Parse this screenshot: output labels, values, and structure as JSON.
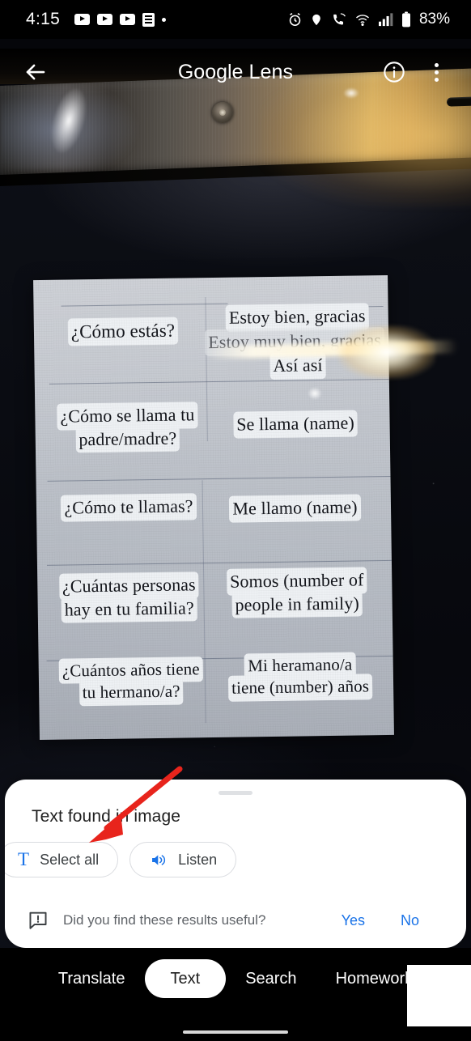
{
  "status_bar": {
    "time": "4:15",
    "battery_percent": "83%",
    "left_icons": [
      "youtube-icon",
      "youtube-icon",
      "youtube-icon",
      "document-icon",
      "dot-icon"
    ],
    "right_icons": [
      "alarm-icon",
      "location-icon",
      "call-forward-icon",
      "wifi-icon",
      "signal-icon",
      "battery-icon"
    ]
  },
  "app_bar": {
    "back_icon": "arrow-left-icon",
    "title_primary": "Google",
    "title_secondary": "Lens",
    "info_icon": "info-icon",
    "overflow_icon": "more-vert-icon"
  },
  "photo": {
    "subject": "handwriting worksheet with Spanish phrases photographed on a dark glossy surface",
    "detected_text_rows": [
      {
        "left": [
          "¿Cómo estás?"
        ],
        "right": [
          "Estoy bien, gracias",
          "Estoy muy bien, gracias",
          "Así así"
        ]
      },
      {
        "left": [
          "¿Cómo se llama tu",
          "padre/madre?"
        ],
        "right": [
          "Se llama (name)"
        ]
      },
      {
        "left": [
          "¿Cómo te llamas?"
        ],
        "right": [
          "Me llamo (name)"
        ]
      },
      {
        "left": [
          "¿Cuántas personas",
          "hay en tu familia?"
        ],
        "right": [
          "Somos (number of",
          "people in family)"
        ]
      },
      {
        "left": [
          "¿Cuántos años tiene",
          "tu hermano/a?"
        ],
        "right": [
          "Mi heramano/a",
          "tiene (number) años"
        ]
      }
    ]
  },
  "sheet": {
    "title": "Text found in image",
    "chips": [
      {
        "label": "Select all",
        "icon": "text-select-icon"
      },
      {
        "label": "Listen",
        "icon": "volume-up-icon"
      }
    ],
    "feedback": {
      "icon": "feedback-icon",
      "question": "Did you find these results useful?",
      "yes": "Yes",
      "no": "No"
    }
  },
  "bottom_nav": {
    "items": [
      {
        "label": "Translate",
        "active": false
      },
      {
        "label": "Text",
        "active": true
      },
      {
        "label": "Search",
        "active": false
      },
      {
        "label": "Homework",
        "active": false
      }
    ]
  },
  "annotation": {
    "type": "arrow",
    "color": "#e8241c",
    "points_to": "Select all"
  },
  "colors": {
    "accent_blue": "#1a73e8",
    "sheet_bg": "#ffffff",
    "nav_bg": "#000000",
    "chip_border": "#dadce0"
  }
}
